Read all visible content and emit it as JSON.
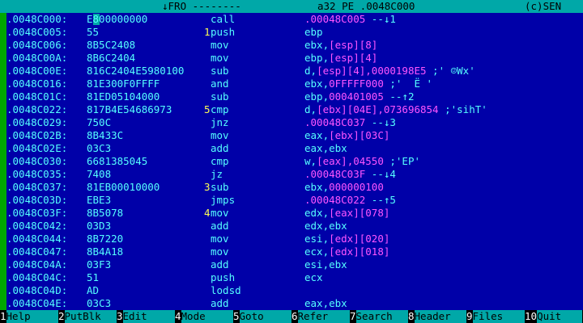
{
  "titlebar": {
    "mode": "↓FRO --------",
    "format": "a32 PE .0048C000",
    "copyright": "(c)SEN"
  },
  "rows": [
    {
      "addr": ".0048C000:",
      "bytes": "E800000000",
      "mark": "",
      "mnemonic": "call",
      "operand": "",
      "label": ".00048C005",
      "comment": " --↓1",
      "cursor": true
    },
    {
      "addr": ".0048C005:",
      "bytes": "55",
      "mark": "1",
      "mnemonic": "push",
      "operand": "ebp",
      "label": "",
      "comment": ""
    },
    {
      "addr": ".0048C006:",
      "bytes": "8B5C2408",
      "mark": "",
      "mnemonic": "mov",
      "operand": "ebx,",
      "label": "[esp][8]",
      "comment": ""
    },
    {
      "addr": ".0048C00A:",
      "bytes": "8B6C2404",
      "mark": "",
      "mnemonic": "mov",
      "operand": "ebp,",
      "label": "[esp][4]",
      "comment": ""
    },
    {
      "addr": ".0048C00E:",
      "bytes": "816C2404E5980100",
      "mark": "",
      "mnemonic": "sub",
      "operand": "d,",
      "label": "[esp][4],0000198E5",
      "comment": " ;' ☺Wx'"
    },
    {
      "addr": ".0048C016:",
      "bytes": "81E300F0FFFF",
      "mark": "",
      "mnemonic": "and",
      "operand": "ebx,",
      "label": "0FFFFF000",
      "comment": " ;'  Ë '"
    },
    {
      "addr": ".0048C01C:",
      "bytes": "81ED05104000",
      "mark": "",
      "mnemonic": "sub",
      "operand": "ebp,",
      "label": "000401005",
      "comment": " --↑2"
    },
    {
      "addr": ".0048C022:",
      "bytes": "817B4E54686973",
      "mark": "5",
      "mnemonic": "cmp",
      "operand": "d,",
      "label": "[ebx][04E],073696854",
      "comment": " ;'sihT'"
    },
    {
      "addr": ".0048C029:",
      "bytes": "750C",
      "mark": "",
      "mnemonic": "jnz",
      "operand": "",
      "label": ".00048C037",
      "comment": " --↓3"
    },
    {
      "addr": ".0048C02B:",
      "bytes": "8B433C",
      "mark": "",
      "mnemonic": "mov",
      "operand": "eax,",
      "label": "[ebx][03C]",
      "comment": ""
    },
    {
      "addr": ".0048C02E:",
      "bytes": "03C3",
      "mark": "",
      "mnemonic": "add",
      "operand": "eax,ebx",
      "label": "",
      "comment": ""
    },
    {
      "addr": ".0048C030:",
      "bytes": "6681385045",
      "mark": "",
      "mnemonic": "cmp",
      "operand": "w,",
      "label": "[eax],04550",
      "comment": " ;'EP'"
    },
    {
      "addr": ".0048C035:",
      "bytes": "7408",
      "mark": "",
      "mnemonic": "jz",
      "operand": "",
      "label": ".00048C03F",
      "comment": " --↓4"
    },
    {
      "addr": ".0048C037:",
      "bytes": "81EB00010000",
      "mark": "3",
      "mnemonic": "sub",
      "operand": "ebx,",
      "label": "000000100",
      "comment": ""
    },
    {
      "addr": ".0048C03D:",
      "bytes": "EBE3",
      "mark": "",
      "mnemonic": "jmps",
      "operand": "",
      "label": ".00048C022",
      "comment": " --↑5"
    },
    {
      "addr": ".0048C03F:",
      "bytes": "8B5078",
      "mark": "4",
      "mnemonic": "mov",
      "operand": "edx,",
      "label": "[eax][078]",
      "comment": ""
    },
    {
      "addr": ".0048C042:",
      "bytes": "03D3",
      "mark": "",
      "mnemonic": "add",
      "operand": "edx,ebx",
      "label": "",
      "comment": ""
    },
    {
      "addr": ".0048C044:",
      "bytes": "8B7220",
      "mark": "",
      "mnemonic": "mov",
      "operand": "esi,",
      "label": "[edx][020]",
      "comment": ""
    },
    {
      "addr": ".0048C047:",
      "bytes": "8B4A18",
      "mark": "",
      "mnemonic": "mov",
      "operand": "ecx,",
      "label": "[edx][018]",
      "comment": ""
    },
    {
      "addr": ".0048C04A:",
      "bytes": "03F3",
      "mark": "",
      "mnemonic": "add",
      "operand": "esi,ebx",
      "label": "",
      "comment": ""
    },
    {
      "addr": ".0048C04C:",
      "bytes": "51",
      "mark": "",
      "mnemonic": "push",
      "operand": "ecx",
      "label": "",
      "comment": ""
    },
    {
      "addr": ".0048C04D:",
      "bytes": "AD",
      "mark": "",
      "mnemonic": "lodsd",
      "operand": "",
      "label": "",
      "comment": ""
    },
    {
      "addr": ".0048C04E:",
      "bytes": "03C3",
      "mark": "",
      "mnemonic": "add",
      "operand": "eax,ebx",
      "label": "",
      "comment": ""
    }
  ],
  "fkeys": [
    {
      "num": "1",
      "label": "Help"
    },
    {
      "num": "2",
      "label": "PutBlk"
    },
    {
      "num": "3",
      "label": "Edit"
    },
    {
      "num": "4",
      "label": "Mode"
    },
    {
      "num": "5",
      "label": "Goto"
    },
    {
      "num": "6",
      "label": "Refer"
    },
    {
      "num": "7",
      "label": "Search"
    },
    {
      "num": "8",
      "label": "Header"
    },
    {
      "num": "9",
      "label": "Files"
    },
    {
      "num": "10",
      "label": "Quit"
    }
  ],
  "colors": {
    "background": "#0000a8",
    "text": "#55ffff",
    "label": "#ff55ff",
    "mark": "#ffff55",
    "bar": "#00a8a8",
    "left_bar": "#00a800"
  }
}
